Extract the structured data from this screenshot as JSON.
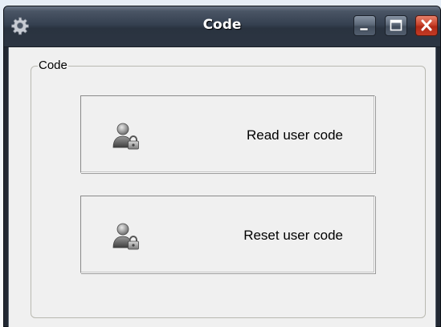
{
  "window": {
    "title": "Code",
    "icons": {
      "app": "gear-icon",
      "minimize": "minimize-icon",
      "maximize": "maximize-icon",
      "close": "close-icon"
    }
  },
  "group": {
    "label": "Code"
  },
  "buttons": [
    {
      "label": "Read user code",
      "icon": "user-lock-icon"
    },
    {
      "label": "Reset user code",
      "icon": "user-lock-icon"
    }
  ],
  "colors": {
    "titlebar": "#354050",
    "close_button": "#c9432c",
    "client_background": "#f0f0f0"
  }
}
